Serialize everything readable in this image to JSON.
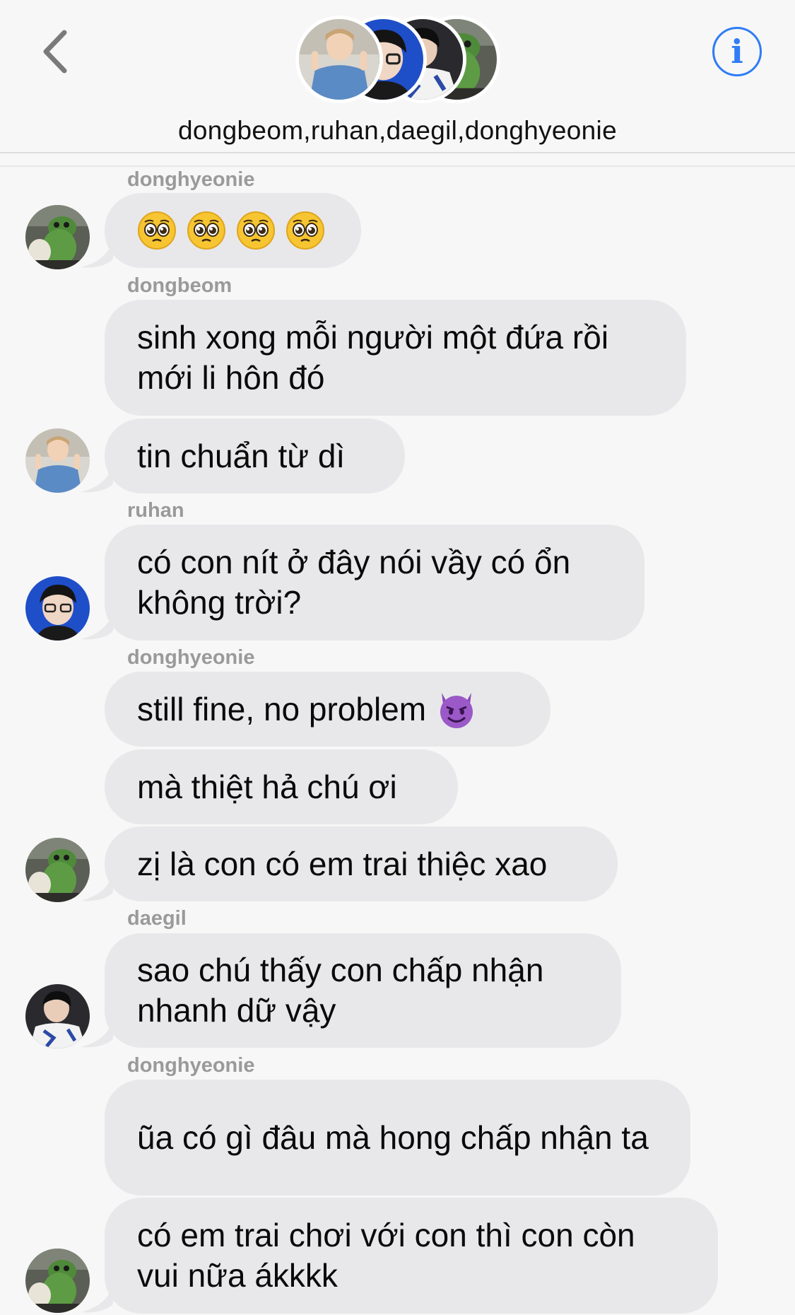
{
  "header": {
    "title": "dongbeom,ruhan,daegil,donghyeonie",
    "back_icon": "chevron-left-icon",
    "info_icon": "info-icon",
    "info_glyph": "i",
    "accent_color": "#2f7cf6"
  },
  "messages": [
    {
      "sender": "donghyeonie",
      "text": "",
      "emoji": "pleading-face-icon x4"
    },
    {
      "sender": "dongbeom",
      "text": "sinh xong mỗi người một đứa rồi mới li hôn đó"
    },
    {
      "sender": "",
      "text": "tin chuẩn từ dì"
    },
    {
      "sender": "ruhan",
      "text": "có con nít ở đây nói vầy có ổn không trời?"
    },
    {
      "sender": "donghyeonie",
      "text": "still fine, no problem",
      "emoji": "smiling-devil-icon"
    },
    {
      "sender": "",
      "text": "mà thiệt hả chú ơi"
    },
    {
      "sender": "",
      "text": "zị là con có em trai thiệc xao"
    },
    {
      "sender": "daegil",
      "text": "sao chú thấy con chấp nhận nhanh dữ vậy"
    },
    {
      "sender": "donghyeonie",
      "text": "ũa có gì đâu mà hong chấp nhận ta"
    },
    {
      "sender": "",
      "text": "có em trai chơi với con thì con còn vui nữa ákkkk"
    }
  ]
}
